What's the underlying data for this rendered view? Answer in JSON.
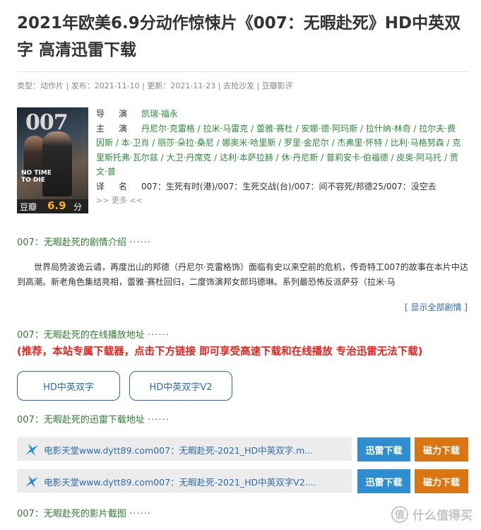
{
  "title": "2021年欧美6.9分动作惊悚片《007：无暇赴死》HD中英双字 高清迅雷下载",
  "meta": {
    "type_label": "类型：",
    "type_value": "动作片",
    "sep1": " | 发布：",
    "published": "2021-11-10",
    "sep2": " | 更新：",
    "updated": "2021-11-23",
    "sep3": " | ",
    "sofa": "去抢沙发",
    "sep4": " | ",
    "review": "豆瓣影评"
  },
  "poster": {
    "logo_text": "007",
    "title_text": "NO TIME TO DIE",
    "douban_label": "豆瓣",
    "douban_score": "6.9",
    "douban_unit": "分"
  },
  "info": {
    "director_label_a": "导",
    "director_label_b": "演",
    "director": "凯瑞·福永",
    "cast_label_a": "主",
    "cast_label_b": "演",
    "cast": "丹尼尔·克雷格 / 拉米·马雷克 / 蕾雅·赛杜 / 安娜·德·阿玛斯 / 拉什纳·林奇 / 拉尔夫·费因斯 / 本·卫肖 / 丽莎·朵拉·桑尼 / 娜奥米·哈里斯 / 罗里·金尼尔 / 杰弗里·怀特 / 比利·马格努森 / 克里斯托弗·瓦尔兹 / 大卫·丹席克 / 达利·本萨拉赫 / 休·丹尼斯 / 普莉安卡·伯福德 / 皮奥·阿马托 / 贾文·普",
    "alias_label_a": "译",
    "alias_label_b": "名",
    "alias": "007：生死有时(港)/007：生死交战(台)/007：间不容死/邦德25/007：没空去",
    "more": ">> 更多 <<"
  },
  "sections": {
    "plot_heading": "007：无暇赴死的剧情介绍",
    "online_heading": "007：无暇赴死的在线播放地址",
    "xunlei_heading": "007：无暇赴死的迅雷下载地址",
    "screens_heading": "007：无暇赴死的影片截图",
    "dots": "······"
  },
  "plot": "世界局势波诡云谲，再度出山的邦德（丹尼尔·克雷格饰）面临有史以来空前的危机，传奇特工007的故事在本片中达到高潮。新老角色集结亮相，蕾雅·赛杜回归，二度饰演邦女郎玛德琳。系列最恐怖反派萨芬（拉米·马",
  "show_all": "[ 显示全部剧情 ]",
  "red_note": "(推荐，本站专属下载器，点击下方链接 即可享受高速下载和在线播放 专治迅雷无法下载)",
  "play_buttons": [
    "HD中英双字",
    "HD中英双字V2"
  ],
  "downloads": [
    {
      "text": "电影天堂www.dytt89.com007：无暇赴死-2021_HD中英双字.m...",
      "xunlei": "迅雷下载",
      "magnet": "磁力下载"
    },
    {
      "text": "电影天堂www.dytt89.com007：无暇赴死-2021_HD中英双字V2....",
      "xunlei": "迅雷下载",
      "magnet": "磁力下载"
    }
  ],
  "watermark": {
    "icon": "值",
    "text": "什么值得买"
  },
  "colors": {
    "link_green": "#2e8a3c",
    "blue": "#2e6ca8",
    "red": "#e8221c",
    "xunlei_btn": "#2f8ed0",
    "magnet_btn": "#d97612",
    "douban_score": "#ffae20"
  }
}
